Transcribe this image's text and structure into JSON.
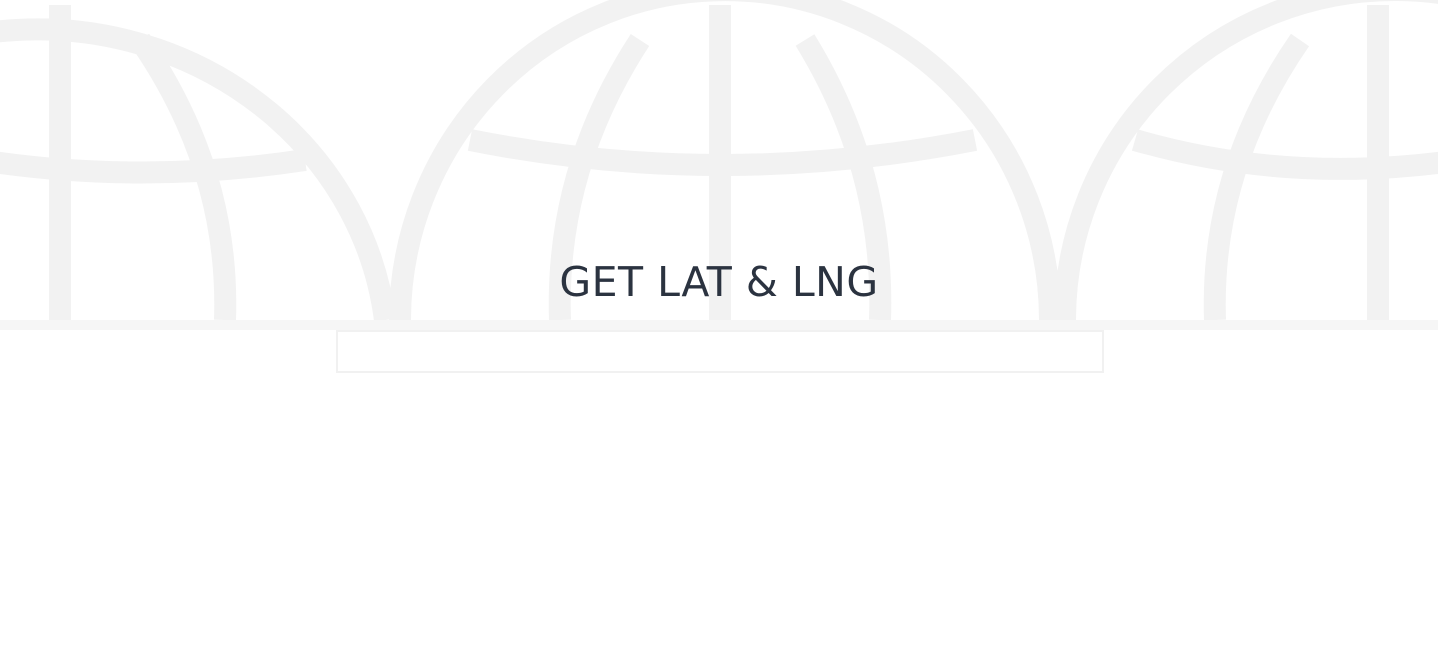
{
  "hero": {
    "title": "GET LAT & LNG",
    "search_placeholder": "",
    "search_value": ""
  },
  "background": {
    "icon": "globe-icon",
    "line_color": "#f2f2f2"
  }
}
